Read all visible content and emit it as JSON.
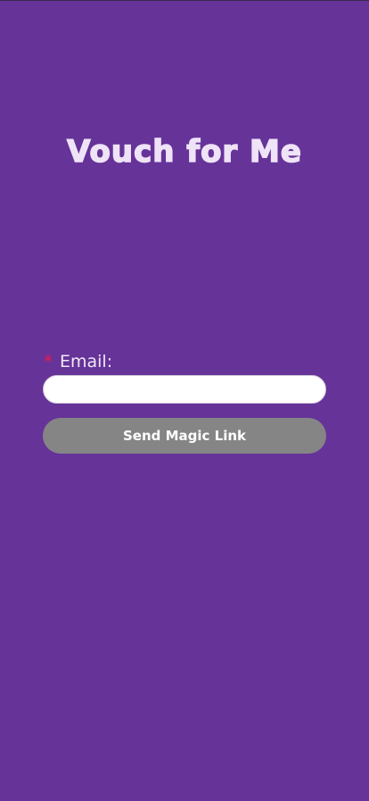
{
  "app": {
    "title": "Vouch for Me"
  },
  "form": {
    "required_marker": "*",
    "email_label": "Email:",
    "email_value": "",
    "email_placeholder": "",
    "submit_label": "Send Magic Link"
  },
  "colors": {
    "background": "#663399",
    "title": "#efe3f7",
    "required_marker": "#e8194e",
    "button_background": "#858585",
    "button_text": "#ffffff"
  }
}
